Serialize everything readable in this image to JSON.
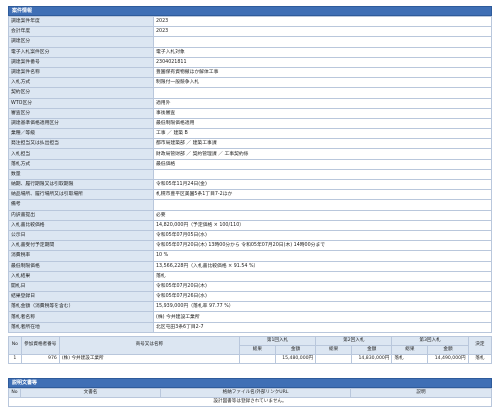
{
  "sections": {
    "info_title": "案件情報",
    "docs_title": "説明文書等"
  },
  "info_rows": [
    {
      "label": "調達案件年度",
      "value": "2023"
    },
    {
      "label": "会計年度",
      "value": "2023"
    },
    {
      "label": "調達区分",
      "value": ""
    },
    {
      "label": "電子入札案件区分",
      "value": "電子入札対象"
    },
    {
      "label": "調達案件番号",
      "value": "2304021811"
    },
    {
      "label": "調達案件名称",
      "value": "豊園保有資物撤ほか解体工事"
    },
    {
      "label": "入札方式",
      "value": "制限付一般競争入札"
    },
    {
      "label": "契約区分",
      "value": ""
    },
    {
      "label": "WTO区分",
      "value": "適用外"
    },
    {
      "label": "審査区分",
      "value": "事後審査"
    },
    {
      "label": "調達基準価格適用区分",
      "value": "最低制限価格適用"
    },
    {
      "label": "業種／等級",
      "value": "工事 ／ 建築 B"
    },
    {
      "label": "発注担当又は払出担当",
      "value": "都市局建築部 ／ 建築工事課"
    },
    {
      "label": "入札担当",
      "value": "財政局管財部 ／ 契約管理課 ／ 工事契約係"
    },
    {
      "label": "落札方式",
      "value": "最低価格"
    },
    {
      "label": "数量",
      "value": ""
    },
    {
      "label": "納期、履行期限又は引取期限",
      "value": "令和05年11月24日(金)"
    },
    {
      "label": "納品場所、履行場所又は引取場所",
      "value": "札幌市豊平区美園5条1丁目7-2ほか"
    },
    {
      "label": "備考",
      "value": ""
    },
    {
      "label": "内訳書提出",
      "value": "必要"
    },
    {
      "label": "入札書比較価格",
      "value": "14,820,000円（予定価格 × 100/110）"
    },
    {
      "label": "公示日",
      "value": "令和05年07月05日(水)"
    },
    {
      "label": "入札書受付予定期間",
      "value": "令和05年07月20日(木) 13時00分から 令和05年07月20日(木) 14時00分まで"
    },
    {
      "label": "消費税率",
      "value": "10 %"
    },
    {
      "label": "最低制限価格",
      "value": "13,566,228円（入札書比較価格 × 91.54 %）"
    },
    {
      "label": "入札結果",
      "value": "落札"
    },
    {
      "label": "開札日",
      "value": "令和05年07月20日(木)"
    },
    {
      "label": "結果登録日",
      "value": "令和05年07月26日(水)"
    },
    {
      "label": "落札金額（消費税等を含む）",
      "value": "15,939,000円（落札率 97.77 %）"
    },
    {
      "label": "落札者名称",
      "value": "(株) 今井建設工業所"
    },
    {
      "label": "落札者所在地",
      "value": "北区屯田3条6丁目2-7"
    }
  ],
  "bid_table": {
    "headers": {
      "no": "No",
      "reg": "参加資格者番号",
      "name": "商号又は名称",
      "r1": "第1回入札",
      "r2": "第2回入札",
      "r3": "第3回入札",
      "result": "決定",
      "summary": "総果",
      "amount": "金額"
    },
    "rows": [
      {
        "no": "1",
        "reg": "976",
        "name": "(株) 今井建設工業所",
        "r1_sum": "",
        "r1_amt": "15,480,000円",
        "r2_sum": "",
        "r2_amt": "14,830,000円",
        "r3_sum": "落札",
        "r3_amt": "14,490,000円",
        "result": "落札"
      }
    ]
  },
  "docs_table": {
    "headers": {
      "no": "No",
      "doc": "文書名",
      "file": "格納ファイル名/外部リンクURL",
      "desc": "説明"
    },
    "empty_message": "設計図書等は登録されていません。"
  }
}
